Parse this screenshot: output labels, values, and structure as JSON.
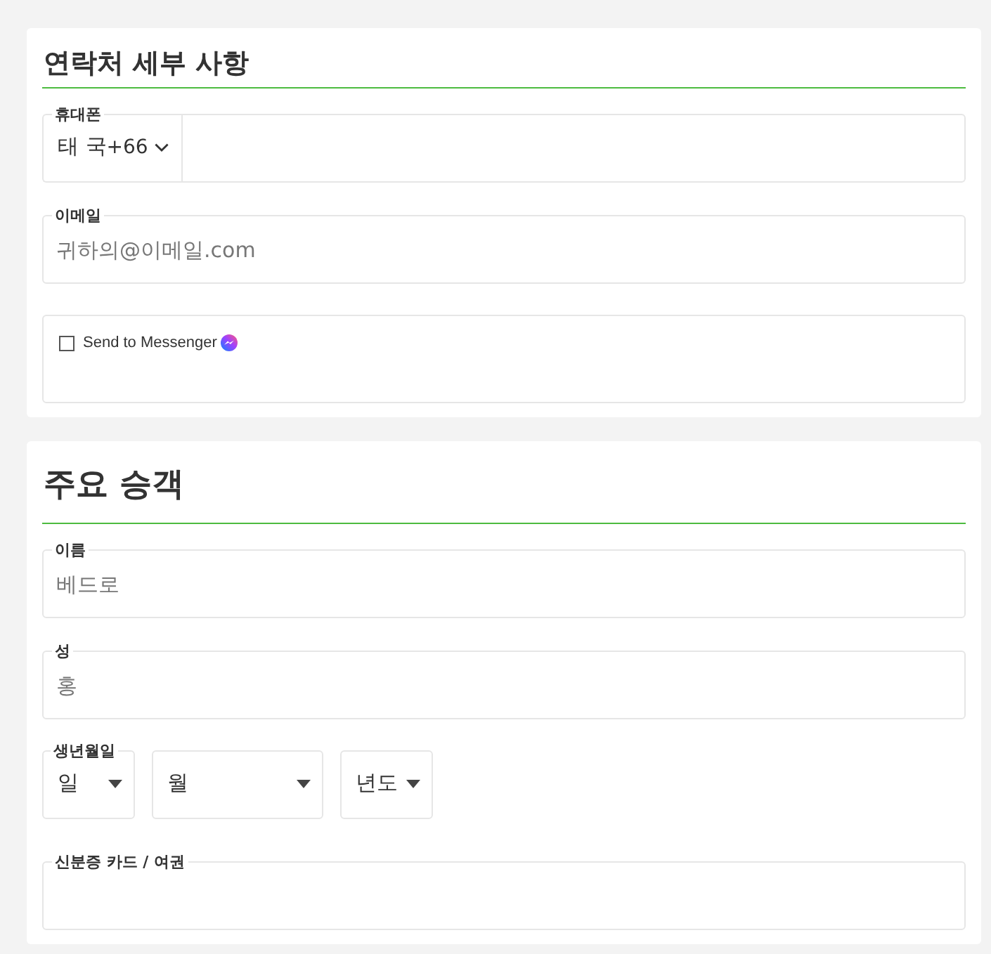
{
  "sections": [
    {
      "kind": "contact",
      "title": "연락처 세부 사항",
      "fields": [
        {
          "kind": "phone",
          "label": "휴대폰",
          "country": "태 국",
          "dial_code": "+66"
        },
        {
          "kind": "text",
          "label": "이메일",
          "placeholder": "귀하의@이메일.com"
        },
        {
          "kind": "checkbox",
          "label": "Send to Messenger",
          "checked": false
        }
      ]
    },
    {
      "kind": "passenger",
      "title": "주요 승객",
      "fields": [
        {
          "kind": "text",
          "label": "이름",
          "placeholder": "베드로"
        },
        {
          "kind": "text",
          "label": "성",
          "placeholder": "홍"
        },
        {
          "kind": "date",
          "label": "생년월일",
          "selects": [
            {
              "text": "일"
            },
            {
              "text": "월"
            },
            {
              "text": "년도"
            }
          ]
        },
        {
          "kind": "text",
          "label": "신분증 카드 / 여권"
        }
      ]
    }
  ]
}
